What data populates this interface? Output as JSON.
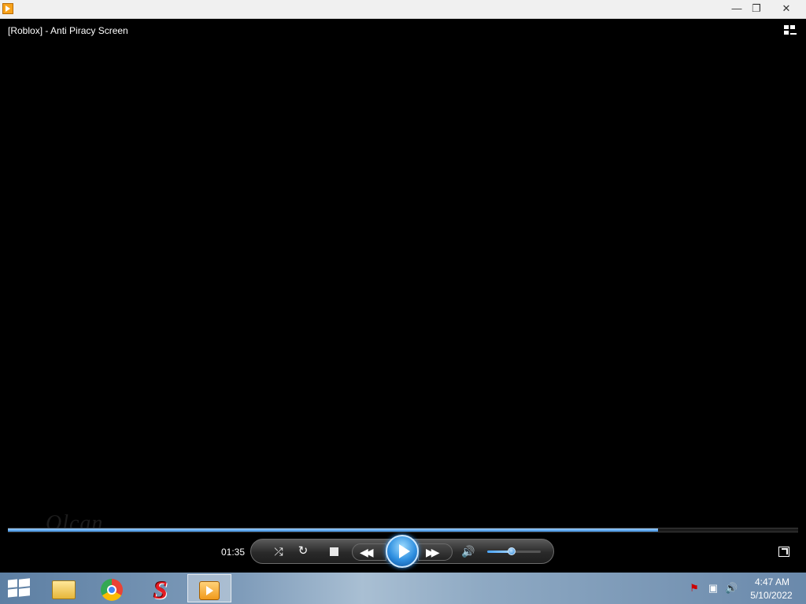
{
  "window": {
    "app_icon": "windows-media-player-icon",
    "minimize_glyph": "—",
    "restore_glyph": "❐",
    "close_glyph": "✕"
  },
  "video": {
    "title": "[Roblox] - Anti Piracy Screen",
    "watermark": "Olcan"
  },
  "player": {
    "elapsed": "01:35",
    "seek_progress": 0.823,
    "volume_level": 0.45,
    "shuffle_glyph": "⤮",
    "repeat_glyph": "↻",
    "prev_glyph": "◀◀",
    "next_glyph": "▶▶",
    "mute_glyph": "🔊",
    "accent_color": "#3a8ee0"
  },
  "taskbar": {
    "apps": [
      {
        "name": "file-explorer-icon"
      },
      {
        "name": "chrome-icon"
      },
      {
        "name": "s-app-icon",
        "glyph": "S"
      },
      {
        "name": "windows-media-player-icon",
        "active": true
      }
    ],
    "tray": {
      "flag_glyph": "⚑",
      "network_glyph": "▣",
      "volume_glyph": "🔊"
    },
    "clock": {
      "time": "4:47 AM",
      "date": "5/10/2022"
    }
  }
}
